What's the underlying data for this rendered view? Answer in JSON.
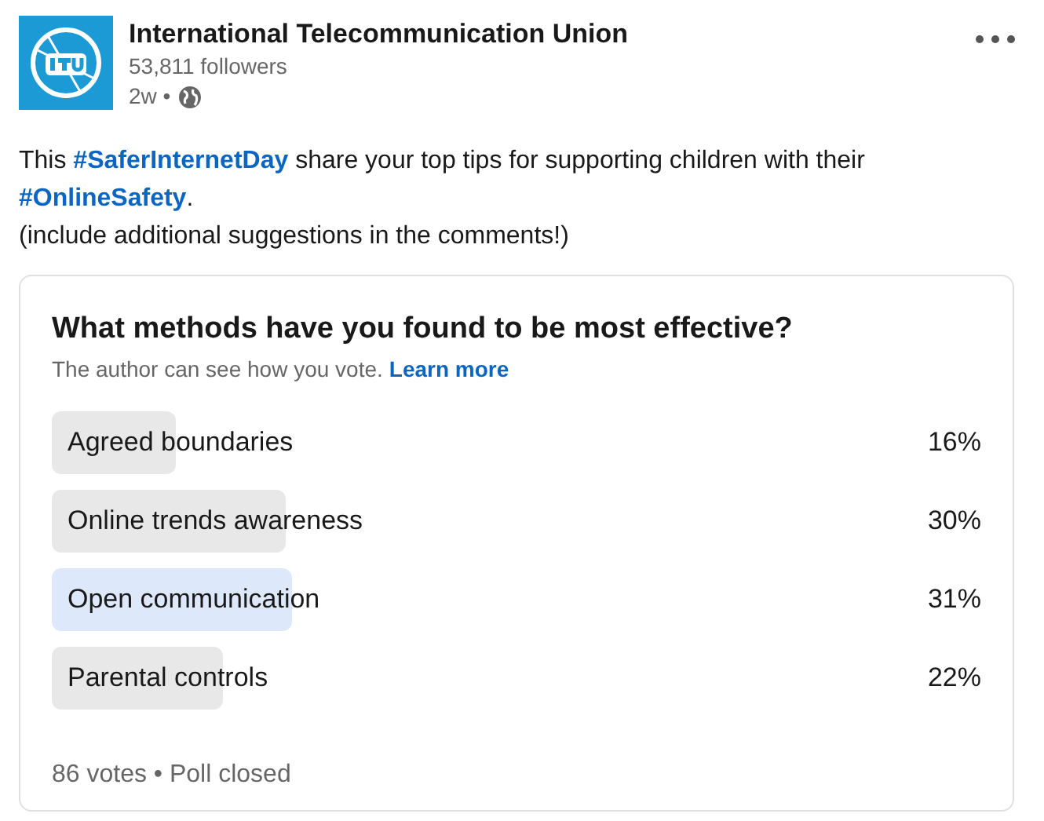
{
  "author": {
    "name": "International Telecommunication Union",
    "followers": "53,811 followers",
    "time": "2w •"
  },
  "post": {
    "text": [
      {
        "kind": "text",
        "text": "This "
      },
      {
        "kind": "hashtag",
        "text": "#SaferInternetDay"
      },
      {
        "kind": "text",
        "text": " share your top tips for supporting children with their "
      },
      {
        "kind": "hashtag",
        "text": "#OnlineSafety"
      },
      {
        "kind": "text",
        "text": "."
      }
    ],
    "note": "(include additional suggestions in the comments!)"
  },
  "poll": {
    "question": "What methods have you found to be most effective?",
    "privacy": "The author can see how you vote.",
    "learn_more": "Learn more",
    "options": [
      {
        "label": "Agreed boundaries",
        "percent": "16%",
        "selected": false
      },
      {
        "label": "Online trends awareness",
        "percent": "30%",
        "selected": false
      },
      {
        "label": "Open communication",
        "percent": "31%",
        "selected": true
      },
      {
        "label": "Parental controls",
        "percent": "22%",
        "selected": false
      }
    ],
    "footer": "86 votes • Poll closed"
  }
}
